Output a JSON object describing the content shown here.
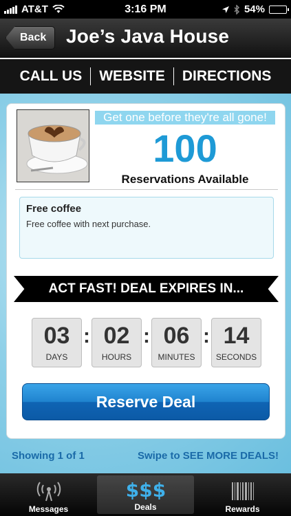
{
  "status_bar": {
    "carrier": "AT&T",
    "time": "3:16 PM",
    "battery": "54%",
    "battery_level": 0.54
  },
  "nav": {
    "back_label": "Back",
    "title": "Joe’s Java House"
  },
  "actions": [
    "CALL US",
    "WEBSITE",
    "DIRECTIONS"
  ],
  "deal": {
    "promo": "Get one before they're all gone!",
    "count": "100",
    "count_label": "Reservations Available",
    "title": "Free coffee",
    "description": "Free coffee with next purchase.",
    "banner": "ACT FAST! DEAL EXPIRES IN...",
    "timer": [
      {
        "value": "03",
        "label": "DAYS"
      },
      {
        "value": "02",
        "label": "HOURS"
      },
      {
        "value": "06",
        "label": "MINUTES"
      },
      {
        "value": "14",
        "label": "SECONDS"
      }
    ],
    "reserve_label": "Reserve Deal"
  },
  "pager": {
    "showing": "Showing 1 of 1",
    "swipe": "Swipe to SEE MORE DEALS!"
  },
  "tabs": [
    {
      "label": "Messages",
      "icon": "antenna-icon"
    },
    {
      "label": "Deals",
      "icon": "dollar-icon"
    },
    {
      "label": "Rewards",
      "icon": "barcode-icon"
    }
  ],
  "colors": {
    "accent": "#1e9ad6",
    "promo_bg": "#8fd6ef",
    "button": "#1f83cf",
    "pager_text": "#1a6aa8"
  }
}
